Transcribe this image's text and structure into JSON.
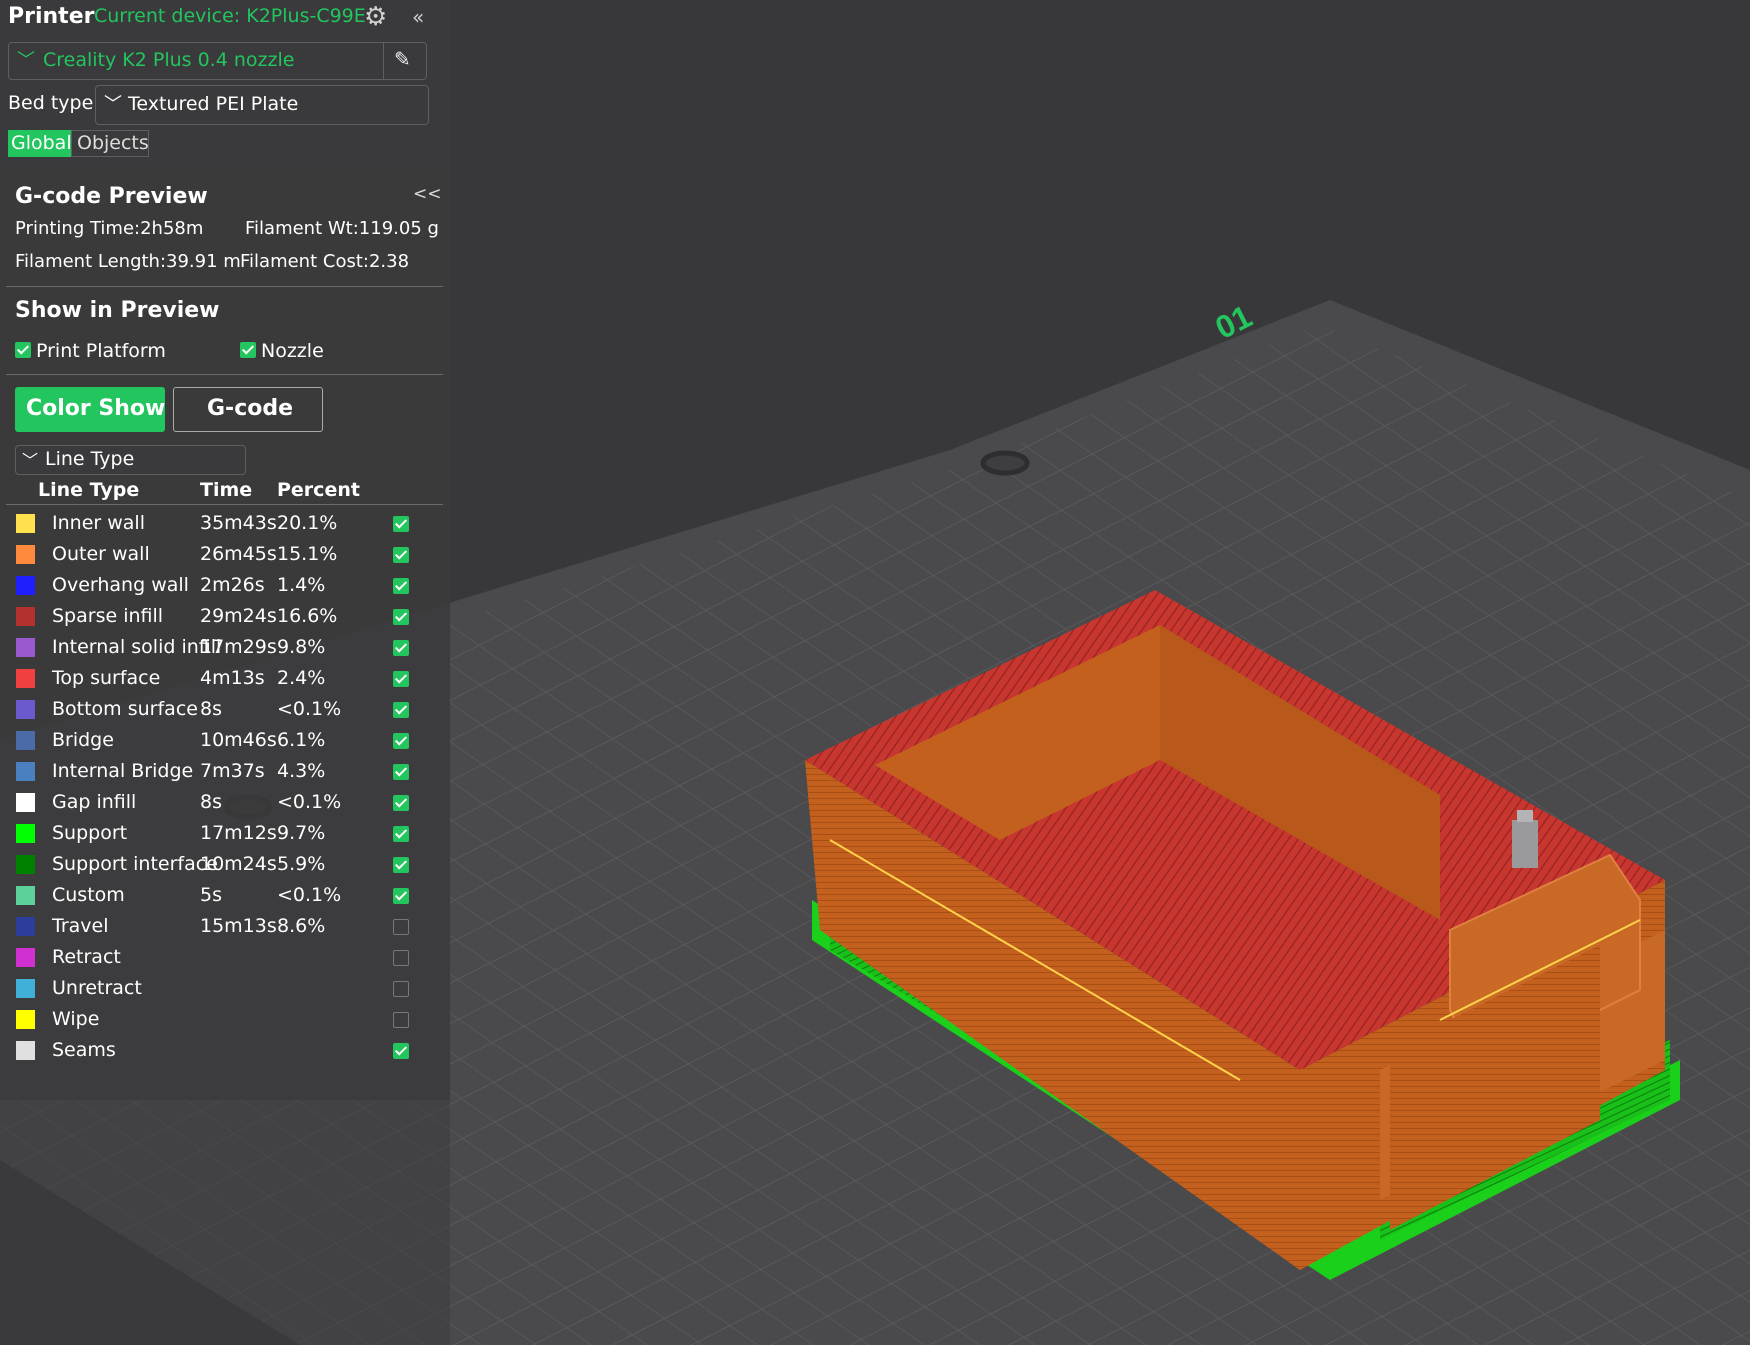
{
  "colors": {
    "accent": "#22c55e",
    "panel": "#3a3a3c",
    "bed": "#4a4a4c"
  },
  "printer": {
    "title": "Printer",
    "device_label": "Current device: K2Plus-C99E",
    "preset": "Creality K2 Plus 0.4 nozzle",
    "bed_type_label": "Bed type",
    "bed_type": "Textured PEI Plate",
    "tabs": [
      "Global",
      "Objects"
    ]
  },
  "preview": {
    "title": "G-code Preview",
    "printing_time": "Printing Time:2h58m",
    "filament_wt": "Filament Wt:119.05 g",
    "filament_length": "Filament Length:39.91 m",
    "filament_cost": "Filament Cost:2.38",
    "show_title": "Show in Preview",
    "print_platform": "Print Platform",
    "nozzle": "Nozzle",
    "color_show": "Color Show",
    "gcode": "G-code",
    "view_select": "Line Type",
    "columns": [
      "Line Type",
      "Time",
      "Percent"
    ],
    "rows": [
      {
        "name": "Inner wall",
        "time": "35m43s",
        "pct": "20.1%",
        "color": "#ffe14d",
        "on": true
      },
      {
        "name": "Outer wall",
        "time": "26m45s",
        "pct": "15.1%",
        "color": "#ff8a3d",
        "on": true
      },
      {
        "name": "Overhang wall",
        "time": "2m26s",
        "pct": "1.4%",
        "color": "#1e1eff",
        "on": true
      },
      {
        "name": "Sparse infill",
        "time": "29m24s",
        "pct": "16.6%",
        "color": "#b3322e",
        "on": true
      },
      {
        "name": "Internal solid infill",
        "time": "17m29s",
        "pct": "9.8%",
        "color": "#9b59d0",
        "on": true
      },
      {
        "name": "Top surface",
        "time": "4m13s",
        "pct": "2.4%",
        "color": "#f04040",
        "on": true
      },
      {
        "name": "Bottom surface",
        "time": "8s",
        "pct": "<0.1%",
        "color": "#6a5acd",
        "on": true
      },
      {
        "name": "Bridge",
        "time": "10m46s",
        "pct": "6.1%",
        "color": "#4a6aa8",
        "on": true
      },
      {
        "name": "Internal Bridge",
        "time": "7m37s",
        "pct": "4.3%",
        "color": "#4a80c0",
        "on": true
      },
      {
        "name": "Gap infill",
        "time": "8s",
        "pct": "<0.1%",
        "color": "#ffffff",
        "on": true
      },
      {
        "name": "Support",
        "time": "17m12s",
        "pct": "9.7%",
        "color": "#00ff00",
        "on": true
      },
      {
        "name": "Support interface",
        "time": "10m24s",
        "pct": "5.9%",
        "color": "#008000",
        "on": true
      },
      {
        "name": "Custom",
        "time": "5s",
        "pct": "<0.1%",
        "color": "#5ed09a",
        "on": true
      },
      {
        "name": "Travel",
        "time": "15m13s",
        "pct": "8.6%",
        "color": "#2a3e9a",
        "on": false
      },
      {
        "name": "Retract",
        "time": "",
        "pct": "",
        "color": "#d030d0",
        "on": false
      },
      {
        "name": "Unretract",
        "time": "",
        "pct": "",
        "color": "#40b0d8",
        "on": false
      },
      {
        "name": "Wipe",
        "time": "",
        "pct": "",
        "color": "#ffff00",
        "on": false
      },
      {
        "name": "Seams",
        "time": "",
        "pct": "",
        "color": "#e0e0e0",
        "on": true
      }
    ]
  },
  "plate": {
    "label": "01"
  }
}
